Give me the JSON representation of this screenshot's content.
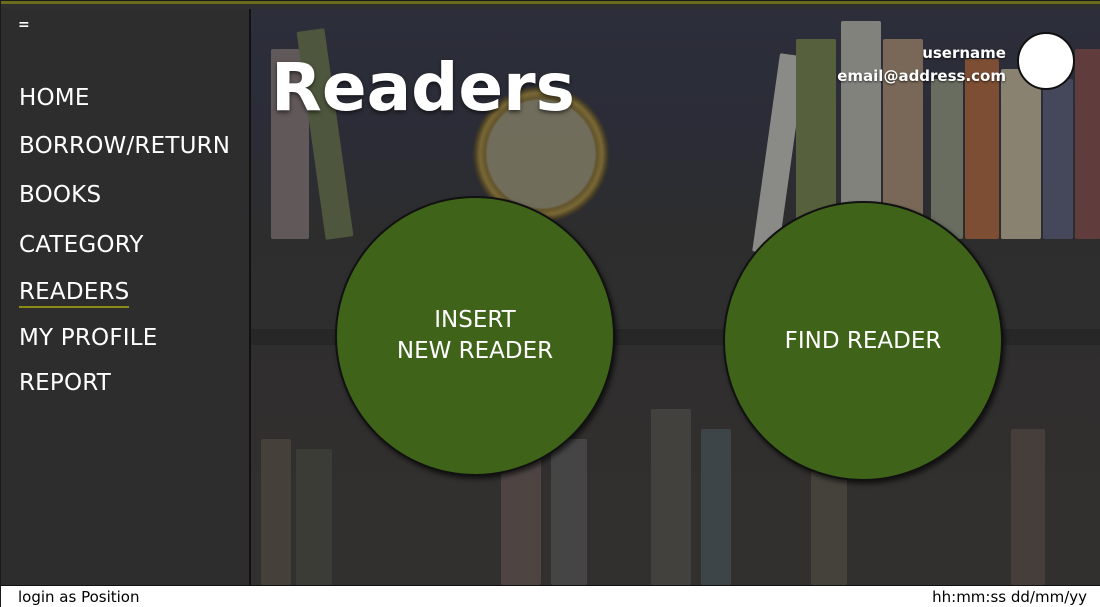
{
  "sidebar": {
    "menu_toggle": "=",
    "items": [
      {
        "label": "HOME"
      },
      {
        "label": "BORROW/RETURN"
      },
      {
        "label": "BOOKS"
      },
      {
        "label": "CATEGORY"
      },
      {
        "label": "READERS",
        "active": true
      },
      {
        "label": "MY PROFILE"
      },
      {
        "label": "REPORT"
      }
    ]
  },
  "header": {
    "title": "Readers",
    "username": "username",
    "email": "email@address.com"
  },
  "actions": {
    "insert_label": "INSERT\nNEW READER",
    "find_label": "FIND READER"
  },
  "status": {
    "login": "login as Position",
    "datetime": "hh:mm:ss dd/mm/yy"
  },
  "colors": {
    "accent": "#6b6b1c",
    "button_green": "#3f6419",
    "sidebar": "#2d2d2d"
  }
}
